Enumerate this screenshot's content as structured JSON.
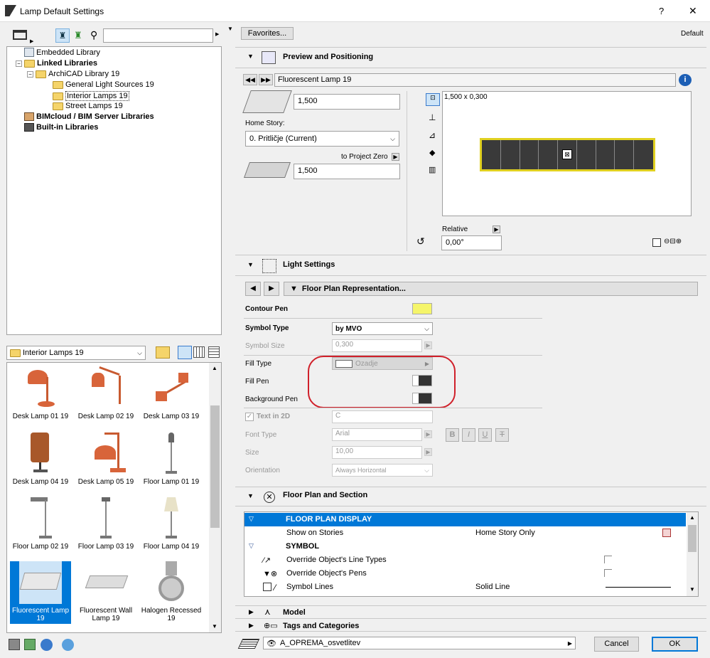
{
  "window": {
    "title": "Lamp Default Settings",
    "help": "?",
    "close": "✕"
  },
  "left": {
    "search_placeholder": "",
    "tree": [
      {
        "label": "Embedded Library",
        "bold": false
      },
      {
        "label": "Linked Libraries",
        "bold": true
      },
      {
        "label": "ArchiCAD Library 19",
        "bold": false
      },
      {
        "label": "General Light Sources 19",
        "bold": false
      },
      {
        "label": "Interior Lamps 19",
        "bold": false
      },
      {
        "label": "Street Lamps 19",
        "bold": false
      },
      {
        "label": "BIMcloud / BIM Server Libraries",
        "bold": true
      },
      {
        "label": "Built-in Libraries",
        "bold": true
      }
    ],
    "folder_select": "Interior Lamps 19",
    "items": [
      {
        "label": "Desk Lamp 01 19"
      },
      {
        "label": "Desk Lamp 02 19"
      },
      {
        "label": "Desk Lamp 03 19"
      },
      {
        "label": "Desk Lamp 04 19"
      },
      {
        "label": "Desk Lamp 05 19"
      },
      {
        "label": "Floor Lamp 01 19"
      },
      {
        "label": "Floor Lamp 02 19"
      },
      {
        "label": "Floor Lamp 03 19"
      },
      {
        "label": "Floor Lamp 04 19"
      },
      {
        "label": "Fluorescent Lamp 19"
      },
      {
        "label": "Fluorescent Wall Lamp 19"
      },
      {
        "label": "Halogen Recessed 19"
      }
    ]
  },
  "right": {
    "favorites": "Favorites...",
    "default": "Default",
    "preview": {
      "header": "Preview and Positioning",
      "name": "Fluorescent Lamp 19",
      "height_value": "1,500",
      "home_story_label": "Home Story:",
      "home_story_value": "0. Pritličje (Current)",
      "to_project_zero": "to Project Zero",
      "elevation_value": "1,500",
      "dimensions": "1,500 x 0,300",
      "relative": "Relative",
      "angle": "0,00°"
    },
    "light": {
      "header": "Light Settings",
      "floor_plan_rep": "Floor Plan Representation...",
      "contour_pen": "Contour Pen",
      "symbol_type_label": "Symbol Type",
      "symbol_type_value": "by MVO",
      "symbol_size_label": "Symbol Size",
      "symbol_size_value": "0,300",
      "fill_type_label": "Fill Type",
      "fill_type_value": "Ozadje",
      "fill_pen_label": "Fill Pen",
      "bg_pen_label": "Background Pen",
      "text_2d_label": "Text in 2D",
      "text_2d_value": "C",
      "font_type_label": "Font Type",
      "font_type_value": "Arial",
      "size_label": "Size",
      "size_value": "10,00",
      "orientation_label": "Orientation",
      "orientation_value": "Always Horizontal",
      "style_b": "B",
      "style_i": "I",
      "style_u": "U",
      "style_s": "T"
    },
    "fps": {
      "header": "Floor Plan and Section",
      "rows": [
        {
          "name": "FLOOR PLAN DISPLAY",
          "value": ""
        },
        {
          "name": "Show on Stories",
          "value": "Home Story Only"
        },
        {
          "name": "SYMBOL",
          "value": ""
        },
        {
          "name": "Override Object's Line Types",
          "value": ""
        },
        {
          "name": "Override Object's Pens",
          "value": ""
        },
        {
          "name": "Symbol Lines",
          "value": "Solid Line"
        }
      ]
    },
    "model": "Model",
    "tags": "Tags and Categories",
    "layer": "A_OPREMA_osvetlitev",
    "cancel": "Cancel",
    "ok": "OK"
  },
  "colors": {
    "accent": "#0078d7",
    "selected_row": "#0078d7",
    "highlight_circle": "#d0202a",
    "pen_yellow": "#f5f56a"
  }
}
